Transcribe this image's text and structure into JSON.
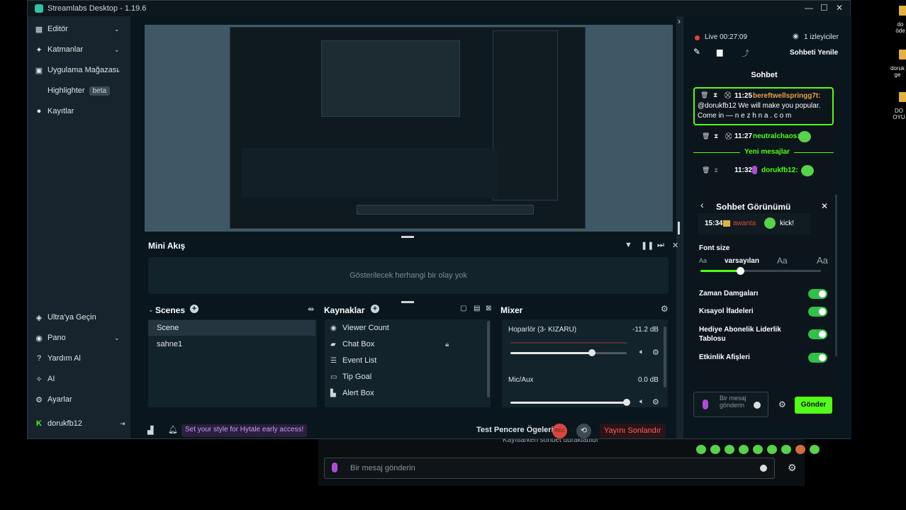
{
  "window": {
    "title": "Streamlabs Desktop - 1.19.6"
  },
  "sidebar": {
    "items": [
      {
        "label": "Editör",
        "icon": "pencil-icon"
      },
      {
        "label": "Katmanlar",
        "icon": "layers-icon"
      },
      {
        "label": "Uygulama Mağazası",
        "icon": "store-icon"
      },
      {
        "label": "Highlighter",
        "icon": "highlighter-icon",
        "badge": "beta"
      },
      {
        "label": "Kayıtlar",
        "icon": "record-icon"
      }
    ],
    "bottom_items": [
      {
        "label": "Ultra'ya Geçin",
        "icon": "diamond-icon"
      },
      {
        "label": "Pano",
        "icon": "dashboard-icon"
      },
      {
        "label": "Yardım Al",
        "icon": "help-icon"
      },
      {
        "label": "AI",
        "icon": "sparkle-icon"
      },
      {
        "label": "Ayarlar",
        "icon": "gear-icon"
      },
      {
        "label": "dorukfb12",
        "icon": "kick-logo-icon"
      }
    ]
  },
  "mini_feed": {
    "title": "Mini Akış",
    "empty_text": "Gösterilecek herhangi bir olay yok"
  },
  "scenes": {
    "title": "Scenes",
    "items": [
      "Scene",
      "sahne1"
    ]
  },
  "sources": {
    "title": "Kaynaklar",
    "items": [
      "Viewer Count",
      "Chat Box",
      "Event List",
      "Tip Goal",
      "Alert Box"
    ]
  },
  "mixer": {
    "title": "Mixer",
    "channels": [
      {
        "name": "Hoparlör (3- KIZARU)",
        "db": "-11.2 dB",
        "level": 0.7
      },
      {
        "name": "Mic/Aux",
        "db": "0.0 dB",
        "level": 1.0
      }
    ]
  },
  "statusbar": {
    "promo": "Set your style for Hytale early access!",
    "test_label": "Test Pencere Ögeleri",
    "rec_label": "REC",
    "end_stream": "Yayını Sonlandır"
  },
  "chat_header": {
    "live": "Live 00:27:09",
    "viewers": "1 izleyiciler",
    "refresh": "Sohbeti Yenile"
  },
  "chat": {
    "title": "Sohbet",
    "messages": [
      {
        "time": "11:25",
        "user": "bereftwellspringg7t:",
        "text": "@dorukfb12 We will make you popular. Come in — n e z h n a . c o m"
      },
      {
        "time": "11:27",
        "user": "neutralchaos:"
      },
      {
        "time": "11:32",
        "user": "dorukfb12:"
      }
    ],
    "new_messages": "Yeni mesajlar"
  },
  "chat_view": {
    "title": "Sohbet Görünümü",
    "preview_time": "15:34",
    "preview_user": "awanta",
    "preview_text": "kick!",
    "font_size_label": "Font size",
    "font_small": "Aa",
    "font_default": "varsayılan",
    "font_medium": "Aa",
    "font_large": "Aa",
    "font_level": 0.33,
    "options": [
      {
        "label": "Zaman Damgaları",
        "on": true
      },
      {
        "label": "Kısayol İfadeleri",
        "on": true
      },
      {
        "label": "Hediye Abonelik Liderlik Tablosu",
        "on": true
      },
      {
        "label": "Etkinlik Afişleri",
        "on": true
      }
    ]
  },
  "chat_input": {
    "placeholder": "Bir mesaj gönderin",
    "send": "Gönder"
  },
  "bottom_bar": {
    "chat_notice": "Kayıtlarken sohbet duraklatıldı",
    "placeholder": "Bir mesaj gönderin"
  },
  "desktop_icons": [
    "do öde",
    "doruk ge",
    "DO OYU"
  ]
}
